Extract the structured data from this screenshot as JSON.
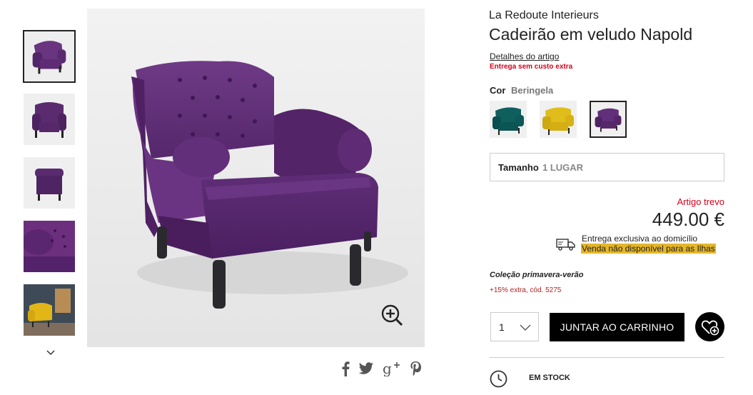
{
  "product": {
    "brand": "La Redoute Interieurs",
    "title": "Cadeirão em veludo Napold",
    "details_link": "Detalhes do artigo",
    "free_delivery": "Entrega sem custo extra"
  },
  "color": {
    "label": "Cor",
    "value": "Beringela",
    "swatches": [
      {
        "name": "teal",
        "hex": "#0f5f5f"
      },
      {
        "name": "yellow",
        "hex": "#d9b617"
      },
      {
        "name": "purple",
        "hex": "#5b2a6e",
        "selected": true
      }
    ]
  },
  "size": {
    "label": "Tamanho",
    "value": "1 LUGAR"
  },
  "price": {
    "note": "Artigo trevo",
    "amount": "449.00 €"
  },
  "shipping": {
    "line1": "Entrega exclusiva ao domicílio",
    "line2": "Venda não disponível para as Ilhas"
  },
  "collection": "Coleção primavera-verão",
  "promo": "+15% extra, cód. 5275",
  "cart": {
    "quantity": "1",
    "add_label": "JUNTAR AO CARRINHO"
  },
  "stock": "EM STOCK",
  "colors": {
    "accent_red": "#d0021b",
    "highlight": "#e4b62a",
    "button_bg": "#000000",
    "chair_purple": "#5b2a6e"
  },
  "icons": {
    "share": [
      "facebook-icon",
      "twitter-icon",
      "google-plus-icon",
      "pinterest-icon"
    ],
    "zoom": "zoom-in-icon",
    "truck": "truck-icon",
    "clock": "clock-icon",
    "wishlist": "heart-plus-icon"
  }
}
